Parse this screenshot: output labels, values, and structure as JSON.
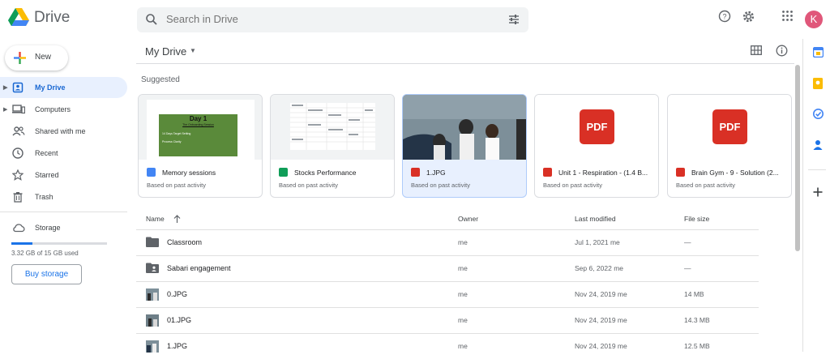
{
  "app": {
    "name": "Drive"
  },
  "search": {
    "placeholder": "Search in Drive"
  },
  "user": {
    "avatar_letter": "K"
  },
  "sidebar": {
    "new_label": "New",
    "items": [
      {
        "label": "My Drive",
        "icon": "my-drive-icon",
        "active": true,
        "expandable": true
      },
      {
        "label": "Computers",
        "icon": "computers-icon",
        "active": false,
        "expandable": true
      },
      {
        "label": "Shared with me",
        "icon": "shared-icon",
        "active": false
      },
      {
        "label": "Recent",
        "icon": "clock-icon",
        "active": false
      },
      {
        "label": "Starred",
        "icon": "star-icon",
        "active": false
      },
      {
        "label": "Trash",
        "icon": "trash-icon",
        "active": false
      }
    ],
    "storage": {
      "label": "Storage",
      "used_text": "3.32 GB of 15 GB used",
      "used_fraction": 0.22,
      "buy_label": "Buy storage"
    }
  },
  "main": {
    "title": "My Drive",
    "suggested_label": "Suggested",
    "cards": [
      {
        "name": "Memory sessions",
        "sub": "Based on past activity",
        "type": "docs",
        "selected": false,
        "slide_title": "Day 1",
        "slide_subtitle": "The Onboarding Session",
        "slide_line1": "14 Days Target Setting",
        "slide_line2": "Process Clarity"
      },
      {
        "name": "Stocks Performance",
        "sub": "Based on past activity",
        "type": "sheets",
        "selected": false
      },
      {
        "name": "1.JPG",
        "sub": "Based on past activity",
        "type": "image",
        "selected": true
      },
      {
        "name": "Unit 1 - Respiration - (1.4 B...",
        "sub": "Based on past activity",
        "type": "pdf",
        "selected": false,
        "badge": "PDF"
      },
      {
        "name": "Brain Gym - 9 - Solution (2...",
        "sub": "Based on past activity",
        "type": "pdf",
        "selected": false,
        "badge": "PDF"
      }
    ],
    "columns": {
      "name": "Name",
      "owner": "Owner",
      "modified": "Last modified",
      "size": "File size"
    },
    "files": [
      {
        "name": "Classroom",
        "type": "folder",
        "owner": "me",
        "modified": "Jul 1, 2021  me",
        "size": "—"
      },
      {
        "name": "Sabari engagement",
        "type": "shared-folder",
        "owner": "me",
        "modified": "Sep 6, 2022  me",
        "size": "—"
      },
      {
        "name": "0.JPG",
        "type": "image",
        "owner": "me",
        "modified": "Nov 24, 2019  me",
        "size": "14 MB"
      },
      {
        "name": "01.JPG",
        "type": "image",
        "owner": "me",
        "modified": "Nov 24, 2019  me",
        "size": "14.3 MB"
      },
      {
        "name": "1.JPG",
        "type": "image",
        "owner": "me",
        "modified": "Nov 24, 2019  me",
        "size": "12.5 MB"
      }
    ]
  },
  "colors": {
    "accent": "#1a73e8",
    "active_bg": "#e8f0fe",
    "pdf_red": "#d93025",
    "docs_blue": "#4285f4",
    "sheets_green": "#0f9d58"
  }
}
